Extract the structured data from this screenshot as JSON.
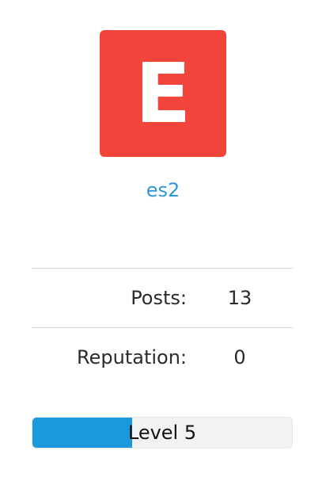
{
  "profile": {
    "avatar_letter": "E",
    "username": "es2",
    "avatar_color": "#f2463d",
    "username_color": "#2f97d8"
  },
  "stats": [
    {
      "label": "Posts:",
      "value": "13"
    },
    {
      "label": "Reputation:",
      "value": "0"
    }
  ],
  "level": {
    "label": "Level 5",
    "progress_fraction": 0.385,
    "fill_color": "#1b99dc"
  }
}
